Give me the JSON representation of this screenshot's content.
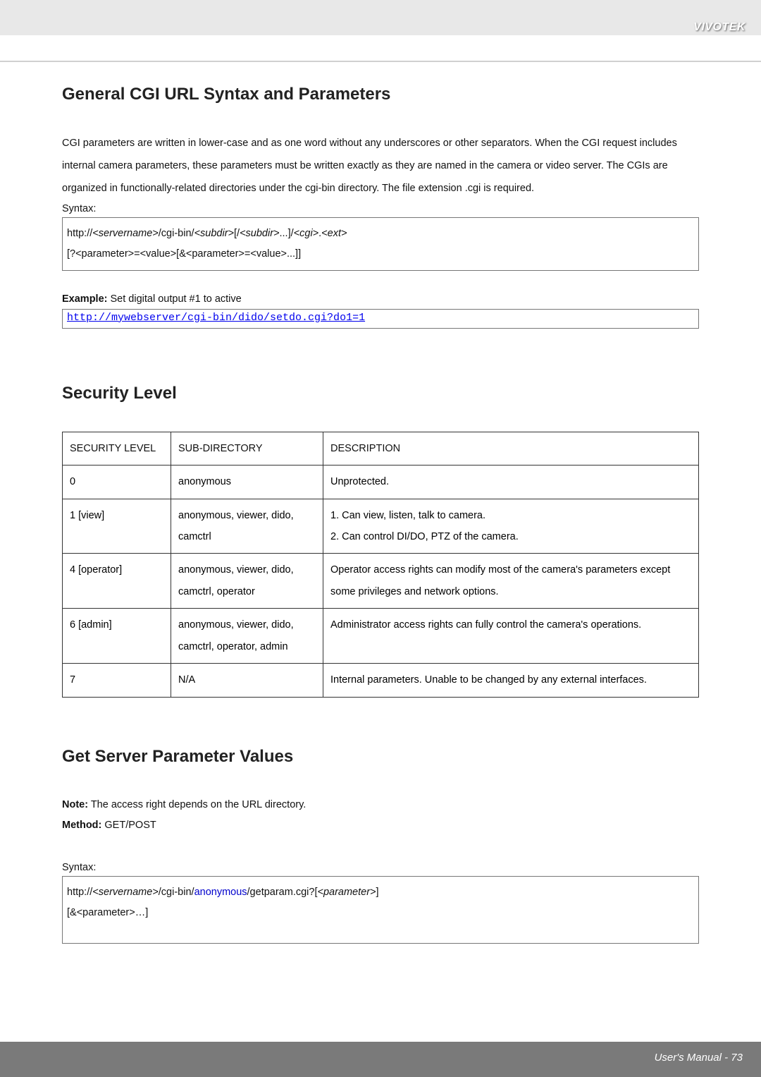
{
  "brand": "VIVOTEK",
  "sections": {
    "general": {
      "title": "General CGI URL Syntax and Parameters",
      "body": "CGI parameters are written in lower-case and as one word without any underscores or other separators. When the CGI request includes internal camera parameters, these parameters must be written exactly as they are named in the camera or video server. The CGIs are organized in functionally-related directories under the cgi-bin directory. The file extension .cgi is required.",
      "syntax_label": "Syntax:",
      "syntax_line1_pre": "http://",
      "syntax_line1_sn": "<servername>",
      "syntax_line1_mid1": "/cgi-bin/",
      "syntax_line1_sd1": "<subdir>",
      "syntax_line1_mid2": "[/",
      "syntax_line1_sd2": "<subdir>",
      "syntax_line1_mid3": "...]/",
      "syntax_line1_cgi": "<cgi>",
      "syntax_line1_dot": ".",
      "syntax_line1_ext": "<ext>",
      "syntax_line2": "[?<parameter>=<value>[&<parameter>=<value>...]]",
      "example_label": "Example:",
      "example_text": " Set digital output #1 to active",
      "example_url": "http://mywebserver/cgi-bin/dido/setdo.cgi?do1=1"
    },
    "security": {
      "title": "Security Level",
      "headers": {
        "c1": "SECURITY LEVEL",
        "c2": "SUB-DIRECTORY",
        "c3": "DESCRIPTION"
      },
      "rows": [
        {
          "level": "0",
          "subdir": "anonymous",
          "desc": "Unprotected."
        },
        {
          "level": "1 [view]",
          "subdir": "anonymous, viewer, dido, camctrl",
          "desc": "1. Can view, listen, talk to camera.\n2. Can control DI/DO, PTZ of the camera."
        },
        {
          "level": "4 [operator]",
          "subdir": "anonymous, viewer, dido, camctrl, operator",
          "desc": "Operator access rights can modify most of the camera's parameters except some privileges and network options."
        },
        {
          "level": "6 [admin]",
          "subdir": "anonymous, viewer, dido, camctrl, operator, admin",
          "desc": "Administrator access rights can fully control the camera's operations."
        },
        {
          "level": "7",
          "subdir": "N/A",
          "desc": "Internal parameters. Unable to be changed by any external interfaces."
        }
      ]
    },
    "getparam": {
      "title": "Get Server Parameter Values",
      "note_label": "Note:",
      "note_text": " The access right depends on the URL directory.",
      "method_label": "Method:",
      "method_text": " GET/POST",
      "syntax_label": "Syntax:",
      "line1_pre": "http://",
      "line1_sn": "<servername>",
      "line1_mid1": "/cgi-bin/",
      "line1_anon": "anonymous",
      "line1_mid2": "/getparam.cgi?[",
      "line1_param": "<parameter>",
      "line1_end": "]",
      "line2": "[&<parameter>…]"
    }
  },
  "footer": "User's Manual - 73"
}
